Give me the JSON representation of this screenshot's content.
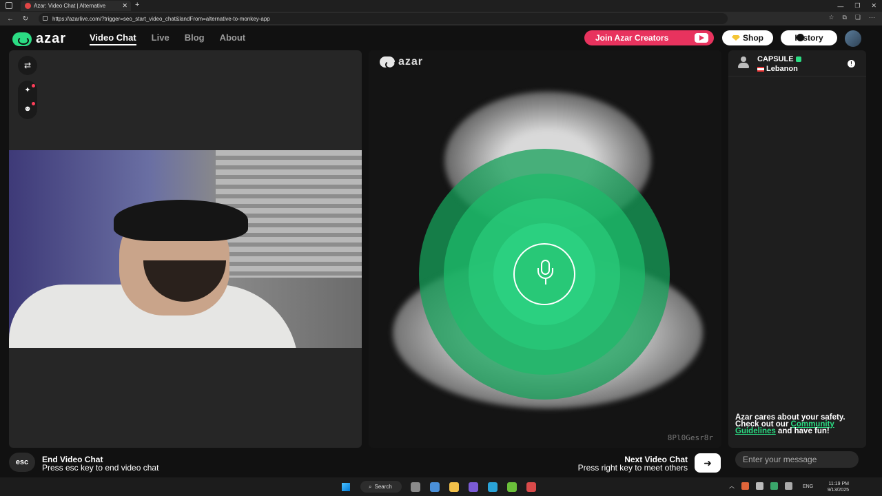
{
  "browser": {
    "tab_title": "Azar: Video Chat | Alternative",
    "url": "https://azarlive.com/?trigger=seo_start_video_chat&landFrom=alternative-to-monkey-app"
  },
  "header": {
    "logo": "azar",
    "nav": [
      "Video Chat",
      "Live",
      "Blog",
      "About"
    ],
    "creators_label": "Join Azar Creators",
    "shop_label": "Shop",
    "history_label": "History"
  },
  "video": {
    "logo": "azar",
    "id_watermark": "8Pl0Gesr8r"
  },
  "partner": {
    "name": "CAPSULE",
    "country": "Lebanon"
  },
  "chat": {
    "safety_prefix": "Azar cares about your safety. Check out our",
    "safety_link": "Community Guidelines",
    "safety_suffix": "and have fun!",
    "placeholder": "Enter your message"
  },
  "controls": {
    "esc_key": "esc",
    "end_title": "End Video Chat",
    "end_sub": "Press esc key to end video chat",
    "next_title": "Next Video Chat",
    "next_sub": "Press right key to meet others"
  },
  "taskbar": {
    "search": "Search",
    "lang": "ENG",
    "time": "11:19 PM",
    "date": "9/13/2025"
  },
  "colors": {
    "brand_green": "#2bdc83",
    "creators_red": "#e8335e"
  }
}
